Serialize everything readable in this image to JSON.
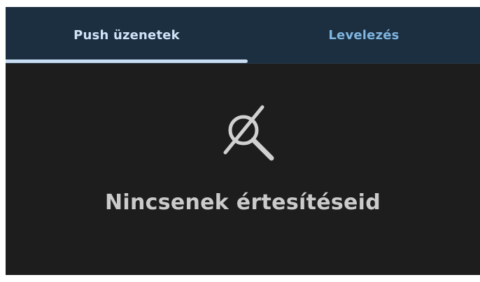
{
  "tabs": [
    {
      "label": "Push üzenetek",
      "active": true
    },
    {
      "label": "Levelezés",
      "active": false
    }
  ],
  "empty_state": {
    "icon": "search-off-icon",
    "message": "Nincsenek értesítéseid"
  },
  "colors": {
    "tabbar_bg": "#1b2f41",
    "content_bg": "#1d1d1d",
    "active_tab_text": "#cfe3f6",
    "inactive_tab_text": "#7fb4de",
    "indicator": "#c9def3",
    "empty_text": "#cbcbcb"
  }
}
